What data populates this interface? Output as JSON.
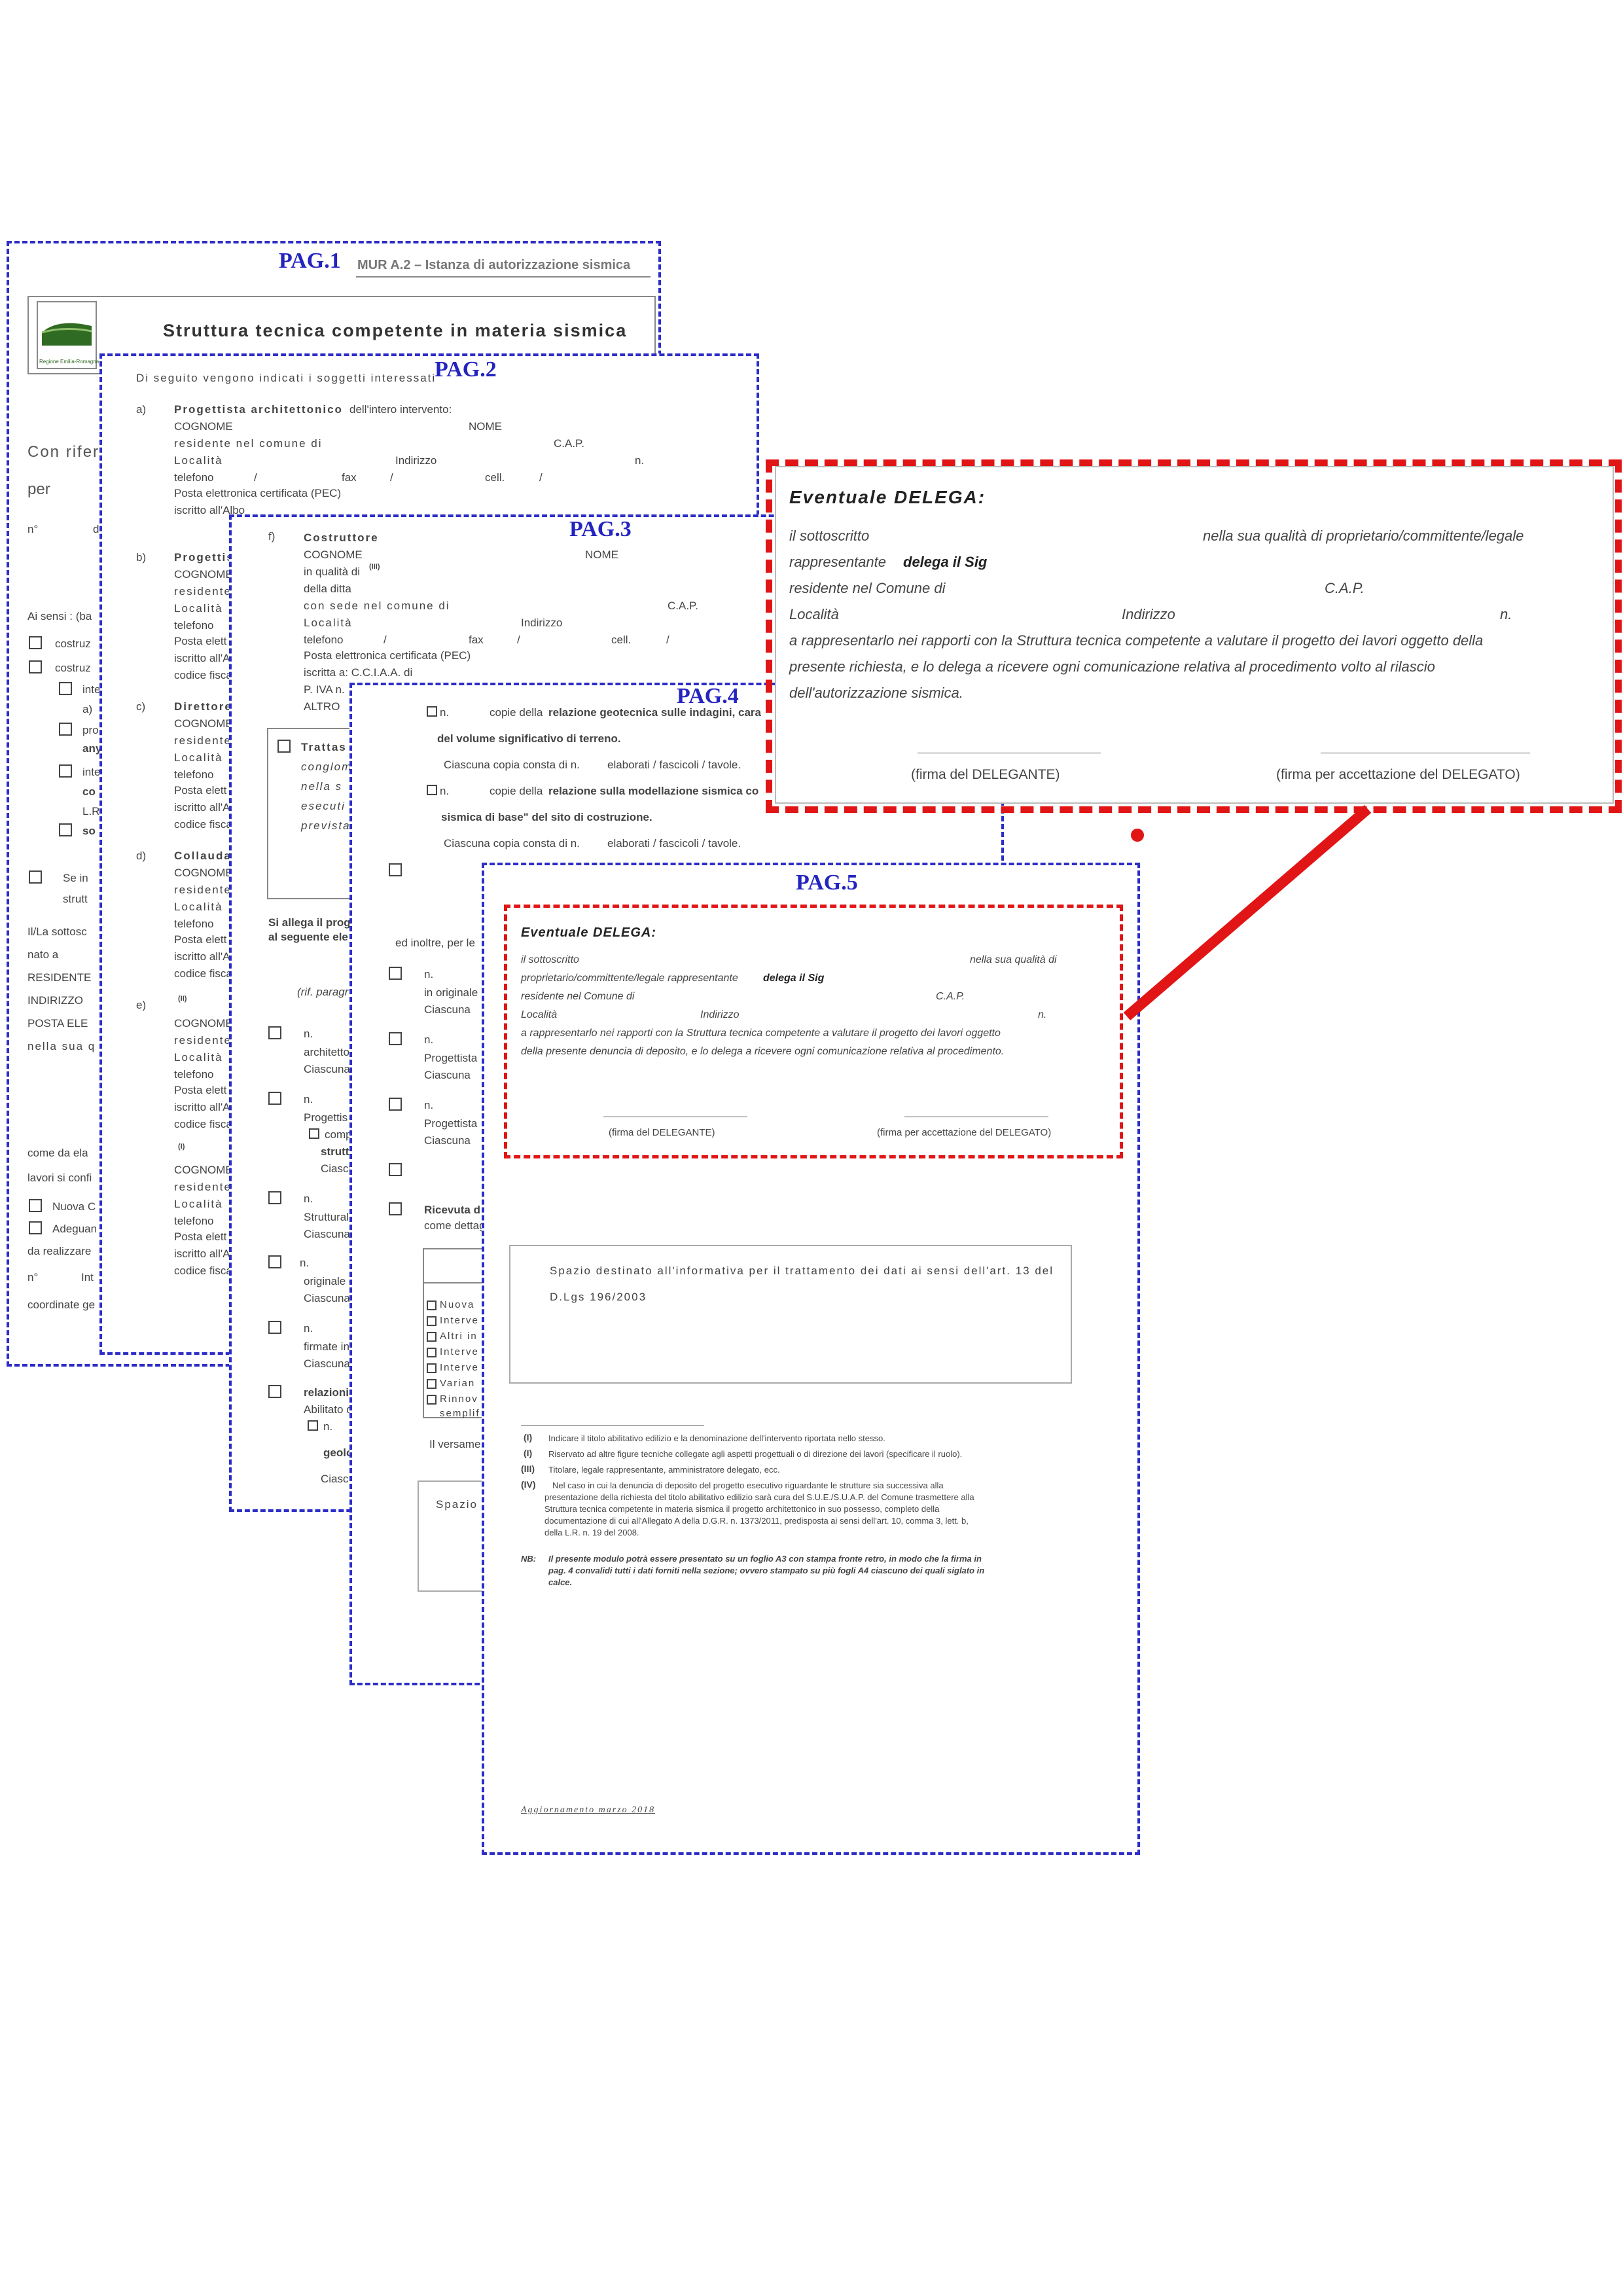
{
  "pages": {
    "p1": {
      "label": "PAG.1",
      "header": "MUR A.2 – Istanza di autorizzazione sismica",
      "logo_caption": "Regione Emilia-Romagna",
      "title": "Struttura tecnica competente in materia sismica",
      "left": [
        "Con rifer",
        "per",
        "n°",
        "d",
        "Ai sensi : (ba",
        "costruz",
        "costruz",
        "inte",
        "a)",
        "pro",
        "any",
        "inte",
        "co",
        "L.R",
        "so",
        "Se in",
        "strutt",
        "Il/La sottosc",
        "nato a",
        "RESIDENTE",
        "INDIRIZZO",
        "POSTA ELE",
        "nella sua q",
        "come da ela",
        "lavori si confi",
        "Nuova C",
        "Adeguan",
        "da realizzare",
        "n°",
        "Int",
        "coordinate ge"
      ]
    },
    "p2": {
      "label": "PAG.2",
      "intro": "Di seguito vengono indicati i soggetti interessati",
      "a_letter": "a)",
      "a_title": "Progettista architettonico",
      "a_title_rest": "dell'intero intervento:",
      "cognome": "COGNOME",
      "nome": "NOME",
      "residente": "residente nel comune di",
      "cap": "C.A.P.",
      "localita": "Località",
      "indirizzo": "Indirizzo",
      "n": "n.",
      "telefono": "telefono",
      "slash": "/",
      "fax": "fax",
      "cell": "cell.",
      "pec": "Posta elettronica certificata (PEC)",
      "iscritto": "iscritto all'Albo",
      "codice": "codice fiscale",
      "b_letter": "b)",
      "b_title": "Progettis",
      "c_letter": "c)",
      "c_title": "Direttore",
      "d_letter": "d)",
      "d_title": "Collauda",
      "e_letter": "e)",
      "sup2": "(II)",
      "sup1": "(I)",
      "cognome_short": "COGNOME",
      "residente_short": "residente",
      "localita_short": "Località",
      "telefono_short": "telefono",
      "posta_short": "Posta elett",
      "iscritto_short": "iscritto all'A",
      "codice_short": "codice fisca"
    },
    "p3": {
      "label": "PAG.3",
      "f_letter": "f)",
      "costruttore": "Costruttore",
      "cognome": "COGNOME",
      "nome": "NOME",
      "qualita": "in qualità di",
      "sup3": "(III)",
      "ditta": "della ditta",
      "sede": "con sede nel comune di",
      "cap": "C.A.P.",
      "localita": "Località",
      "indirizzo": "Indirizzo",
      "telefono": "telefono",
      "slash": "/",
      "fax": "fax",
      "cell": "cell.",
      "pec": "Posta elettronica certificata (PEC)",
      "iscritta": "iscritta a: C.C.I.A.A. di",
      "piva": "P. IVA n.",
      "altro": "ALTRO",
      "trattas": "Trattas",
      "conglom": "conglom",
      "nella": "nella s",
      "esecuti": "esecuti",
      "prevista": "prevista",
      "allega1": "Si allega il prog",
      "allega2": "al seguente ele",
      "rif": "(rif. paragr",
      "n": "n.",
      "architetto": "architetto",
      "ciascuna": "Ciascuna",
      "progettis": "Progettis",
      "comp": "comp",
      "strutt": "strutt",
      "ciascu": "Ciascu",
      "strutturali": "Strutturali",
      "originale": "originale d",
      "firmate": "firmate in",
      "relazioni": "relazioni",
      "abilitato": "Abilitato d",
      "geolo": "geolo",
      "ciasc": "Ciasc"
    },
    "p4": {
      "label": "PAG.4",
      "n": "n.",
      "copie_geo": "copie della",
      "geo_bold": "relazione geotecnica sulle indagini, cara",
      "volume": "del volume significativo di terreno.",
      "ciascuna_copia": "Ciascuna copia consta di n.",
      "elaborati": "elaborati / fascicoli / tavole.",
      "modellazione": "relazione sulla modellazione sismica co",
      "sismica": "sismica di base\" del sito di costruzione.",
      "inoltre": "ed inoltre, per le",
      "originale": "in originale",
      "ciascuna": "Ciascuna",
      "progettista": "Progettista",
      "ricevuta": "Ricevuta d",
      "come": "come dettag",
      "table": [
        "Nuova",
        "Interve",
        "Altri in",
        "Interve",
        "Interve",
        "Varian",
        "Rinnov",
        "semplif"
      ],
      "versame": "Il versame",
      "spazio": "Spazio"
    },
    "p5": {
      "label": "PAG.5",
      "delega_title": "Eventuale DELEGA:",
      "l1a": "il sottoscritto",
      "l1b": "nella sua qualità di",
      "l2a": "proprietario/committente/legale rappresentante",
      "l2b": "delega il Sig",
      "l3a": "residente nel Comune di",
      "l3b": "C.A.P.",
      "l4a": "Località",
      "l4b": "Indirizzo",
      "l4c": "n.",
      "l5": "a rappresentarlo nei rapporti con la Struttura tecnica competente a valutare il progetto dei lavori oggetto",
      "l6": "della presente denuncia di deposito, e lo delega a ricevere ogni comunicazione relativa al procedimento.",
      "sig1": "(firma del DELEGANTE)",
      "sig2": "(firma per accettazione del DELEGATO)",
      "privacy1": "Spazio destinato all'informativa per il trattamento dei dati ai sensi dell'art. 13 del",
      "privacy2": "D.Lgs 196/2003",
      "notes": [
        {
          "k": "(I)",
          "t": "Indicare il titolo abilitativo edilizio e la denominazione dell'intervento riportata nello stesso."
        },
        {
          "k": "(I)",
          "t": "Riservato ad altre figure tecniche collegate agli aspetti progettuali o di direzione dei lavori (specificare il ruolo)."
        },
        {
          "k": "(III)",
          "t": "Titolare, legale rappresentante, amministratore delegato, ecc."
        },
        {
          "k": "(IV)",
          "t": "Nel caso in cui la denuncia di deposito del progetto esecutivo riguardante le strutture sia successiva alla"
        }
      ],
      "note4_more": [
        "presentazione della richiesta del titolo abilitativo edilizio sarà cura del S.U.E./S.U.A.P. del Comune trasmettere alla",
        "Struttura tecnica competente in materia sismica il progetto architettonico in suo possesso, completo della",
        "documentazione di cui all'Allegato A della D.G.R. n. 1373/2011, predisposta ai sensi dell'art. 10, comma 3, lett. b,",
        "della L.R. n. 19 del 2008."
      ],
      "nb_k": "NB:",
      "nb": [
        "Il presente modulo potrà essere presentato su un foglio A3 con stampa fronte retro, in modo che la firma in",
        "pag. 4 convalidi tutti i dati forniti nella sezione; ovvero stampato su più fogli A4 ciascuno dei quali siglato in",
        "calce."
      ],
      "footer": "Aggiornamento marzo 2018"
    },
    "zoom": {
      "title": "Eventuale DELEGA:",
      "l1a": "il sottoscritto",
      "l1b": "nella sua qualità di proprietario/committente/legale",
      "l2a": "rappresentante",
      "l2b": "delega il Sig",
      "l3a": "residente nel Comune di",
      "l3b": "C.A.P.",
      "l4a": "Località",
      "l4b": "Indirizzo",
      "l4c": "n.",
      "l5": "a rappresentarlo nei rapporti con la Struttura tecnica competente a valutare il progetto dei lavori oggetto della",
      "l6": "presente richiesta, e lo delega a ricevere ogni comunicazione relativa al procedimento volto al rilascio",
      "l7": "dell'autorizzazione sismica.",
      "sig1": "(firma del DELEGANTE)",
      "sig2": "(firma per accettazione del DELEGATO)"
    }
  },
  "colors": {
    "page_border": "#2d2dc8",
    "highlight": "#e11515"
  }
}
